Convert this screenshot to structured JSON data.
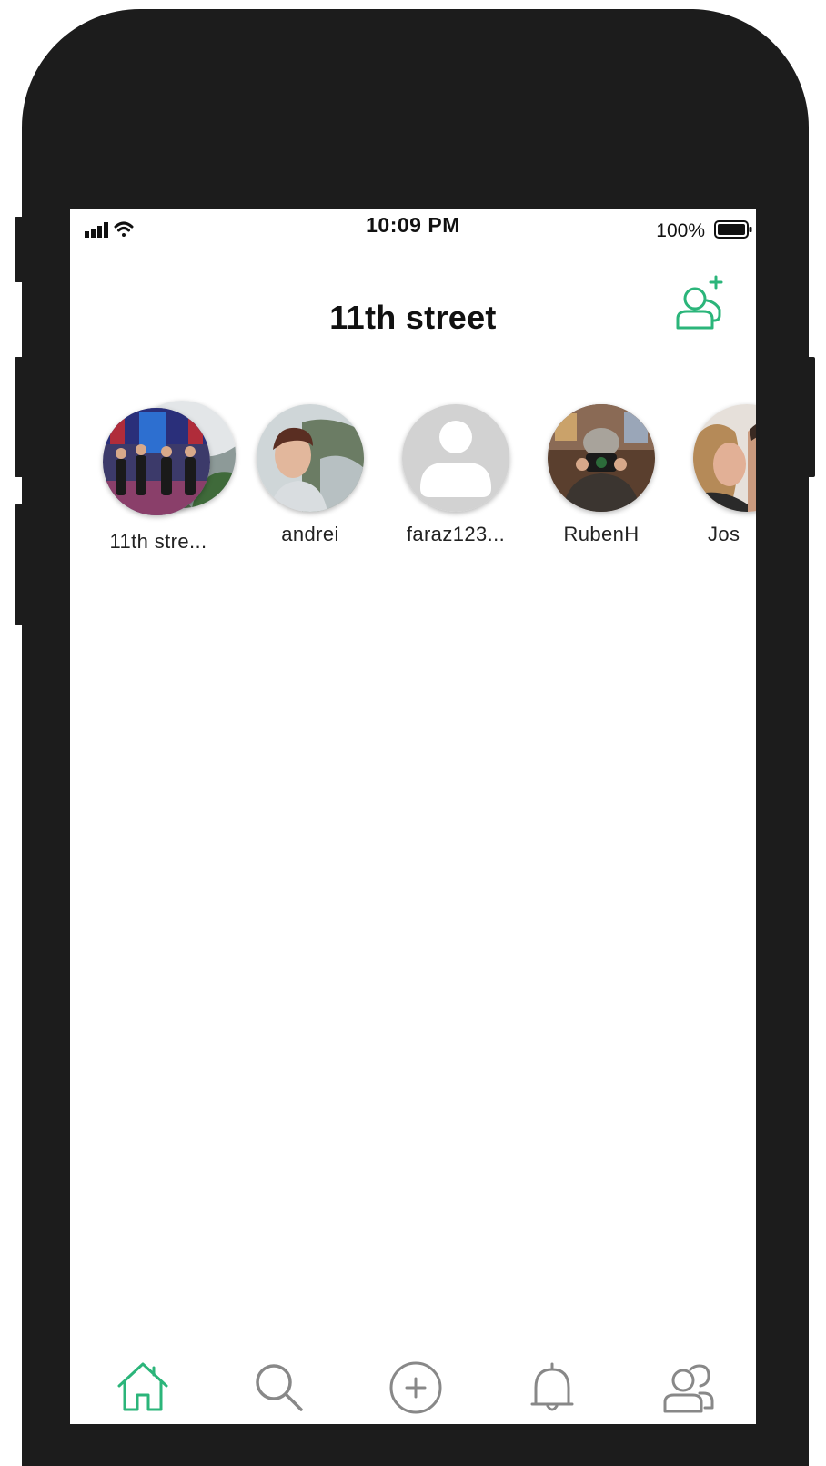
{
  "status_bar": {
    "time": "10:09 PM",
    "battery_percent": "100%",
    "icons": [
      "signal-icon",
      "wifi-icon",
      "battery-icon"
    ]
  },
  "header": {
    "title": "11th street",
    "add_friend_icon": "add-friend-icon"
  },
  "stories": [
    {
      "label": "11th stre..."
    },
    {
      "label": "andrei"
    },
    {
      "label": "faraz123..."
    },
    {
      "label": "RubenH"
    },
    {
      "label": "Jos"
    }
  ],
  "tabbar": {
    "tabs": [
      {
        "icon": "home-icon",
        "active": true
      },
      {
        "icon": "search-icon",
        "active": false
      },
      {
        "icon": "add-circle-icon",
        "active": false
      },
      {
        "icon": "bell-icon",
        "active": false
      },
      {
        "icon": "friends-icon",
        "active": false
      }
    ]
  },
  "colors": {
    "accent": "#2bb57a",
    "inactive_icon": "#888888",
    "device_frame": "#1c1c1c"
  }
}
